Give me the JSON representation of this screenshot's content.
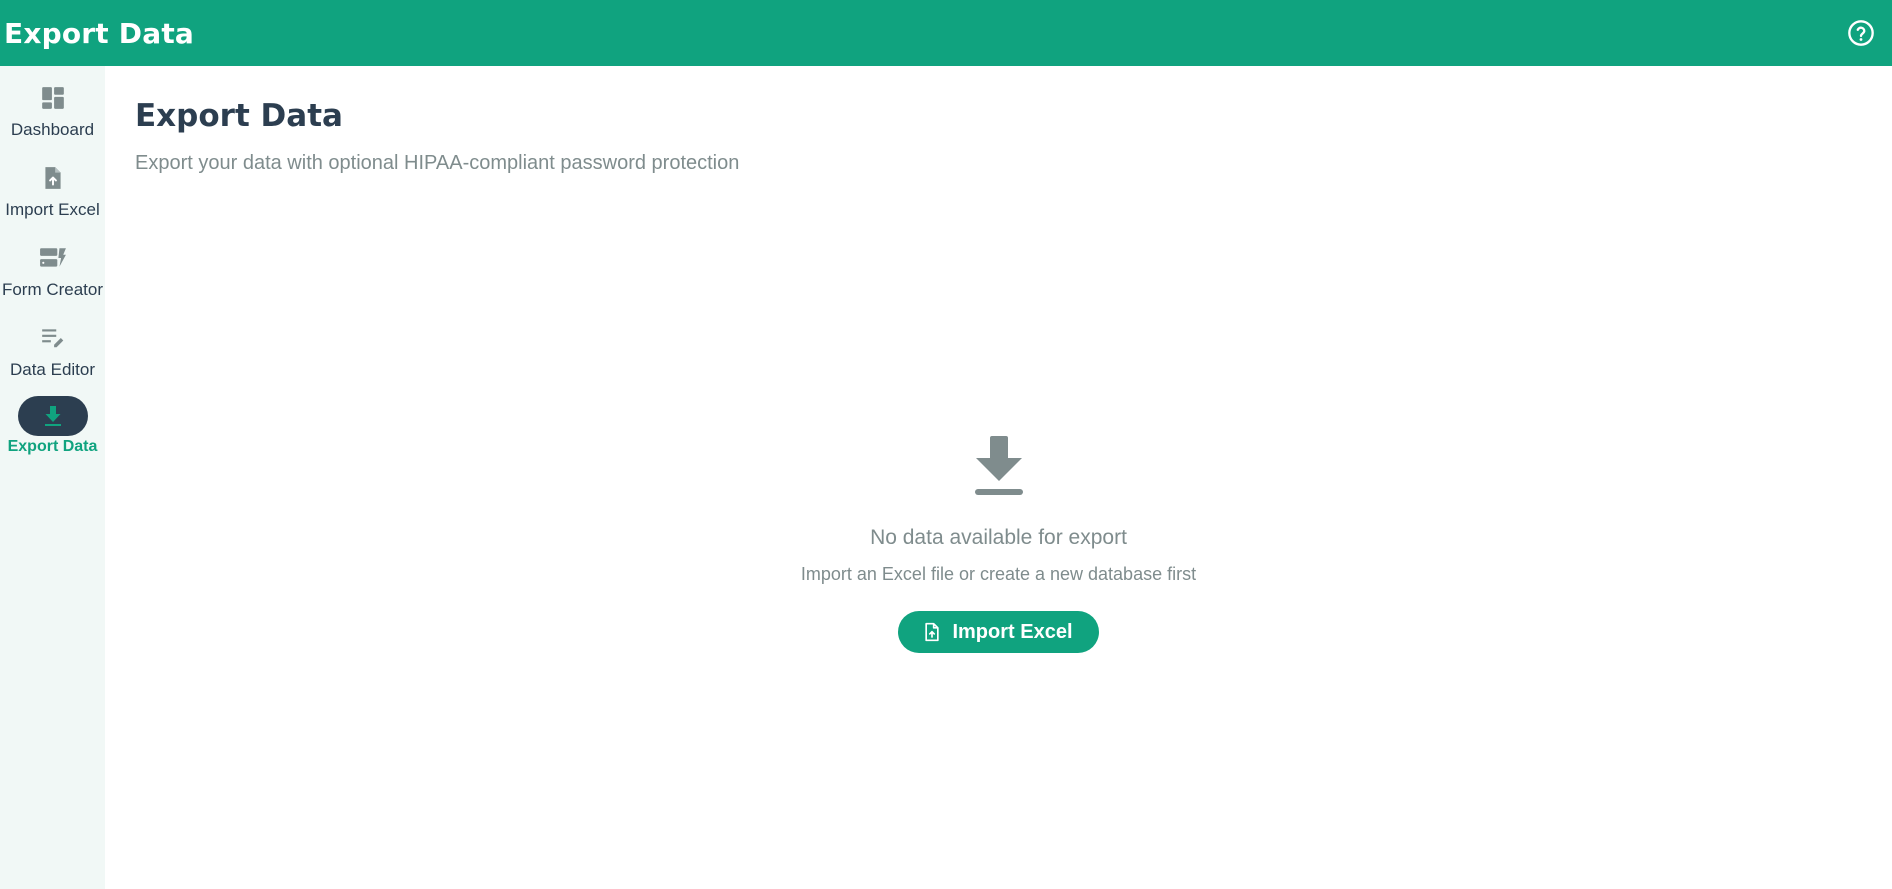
{
  "header": {
    "title": "Export Data",
    "help_icon": "help-circle-icon"
  },
  "sidebar": {
    "items": [
      {
        "label": "Dashboard",
        "icon": "dashboard-icon",
        "active": false
      },
      {
        "label": "Import Excel",
        "icon": "file-upload-icon",
        "active": false
      },
      {
        "label": "Form Creator",
        "icon": "form-creator-icon",
        "active": false
      },
      {
        "label": "Data Editor",
        "icon": "edit-list-icon",
        "active": false
      },
      {
        "label": "Export Data",
        "icon": "download-icon",
        "active": true
      }
    ]
  },
  "main": {
    "title": "Export Data",
    "subtitle": "Export your data with optional HIPAA-compliant password protection",
    "empty_state": {
      "icon": "download-icon",
      "title": "No data available for export",
      "description": "Import an Excel file or create a new database first",
      "button_label": "Import Excel",
      "button_icon": "file-upload-icon"
    }
  },
  "colors": {
    "primary": "#10a37f",
    "dark": "#2c3e50",
    "muted": "#7f8c8d",
    "sidebar_bg": "#f1f8f6"
  }
}
